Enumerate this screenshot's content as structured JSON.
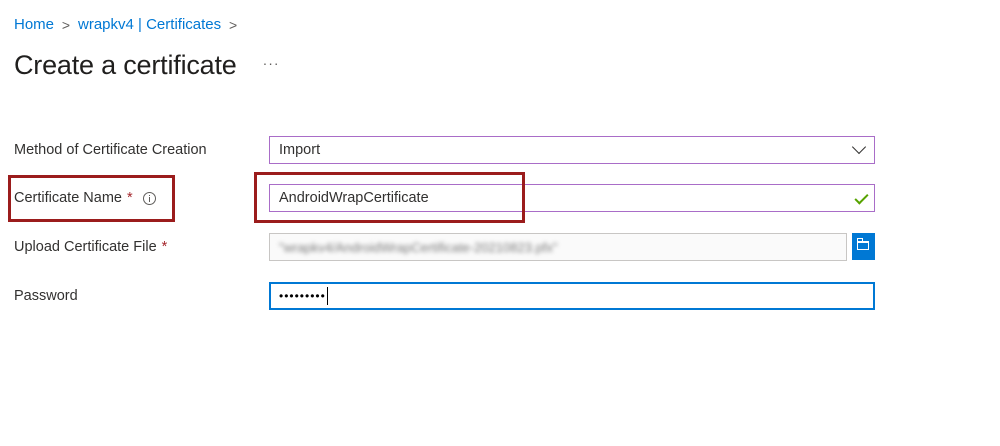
{
  "breadcrumb": {
    "items": [
      "Home",
      "wrapkv4 | Certificates"
    ],
    "separator": ">"
  },
  "header": {
    "title": "Create a certificate",
    "more_label": "···"
  },
  "form": {
    "method": {
      "label": "Method of Certificate Creation",
      "value": "Import"
    },
    "name": {
      "label": "Certificate Name",
      "required_mark": "*",
      "value": "AndroidWrapCertificate",
      "valid": true
    },
    "upload": {
      "label": "Upload Certificate File",
      "required_mark": "*",
      "value": "\"wrapkv4/AndroidWrapCertificate-20210823.pfx\""
    },
    "password": {
      "label": "Password",
      "value": "•••••••••"
    }
  },
  "colors": {
    "accent": "#0078d4",
    "highlight": "#9b1c1c",
    "valid": "#57a300",
    "required": "#a4262c"
  }
}
